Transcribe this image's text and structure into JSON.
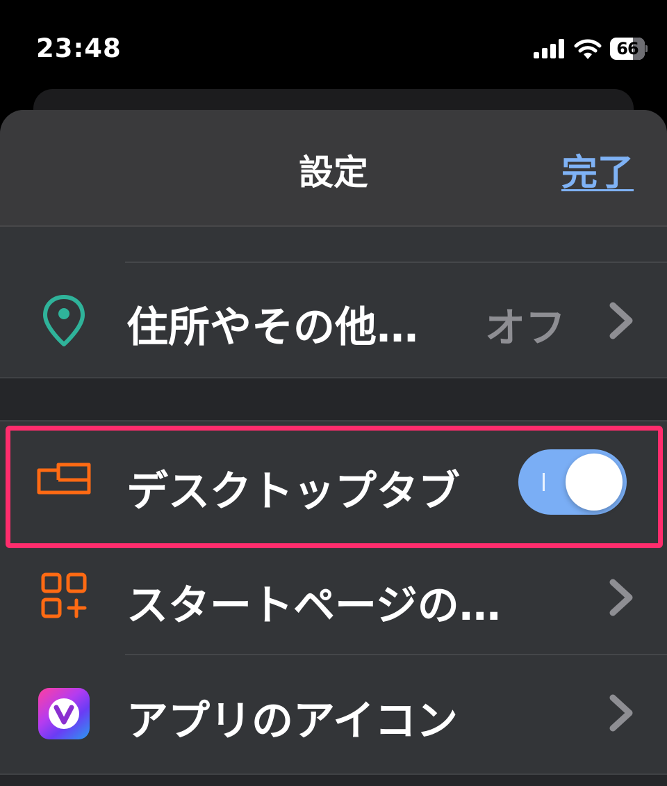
{
  "status_bar": {
    "time": "23:48",
    "battery_level": "66",
    "battery_fraction": 0.66,
    "icons": [
      "cellular-signal-icon",
      "wifi-icon",
      "battery-icon"
    ]
  },
  "header": {
    "title": "設定",
    "done_label": "完了",
    "done_color": "#7fb2f5"
  },
  "settings": {
    "address_row": {
      "label": "住所やその他…",
      "value": "オフ",
      "icon": "location-pin-icon",
      "icon_color": "#2fb39a"
    },
    "desktop_tabs_row": {
      "label": "デスクトップタブ",
      "icon": "desktop-tabs-icon",
      "icon_color": "#ff6a13",
      "toggle_on": true,
      "toggle_color": "#7aaef5"
    },
    "start_page_row": {
      "label": "スタートページの…",
      "icon": "start-page-grid-icon",
      "icon_color": "#ff6a13"
    },
    "app_icon_row": {
      "label": "アプリのアイコン",
      "icon": "vivaldi-app-icon"
    }
  },
  "highlight_color": "#ff2d6d"
}
